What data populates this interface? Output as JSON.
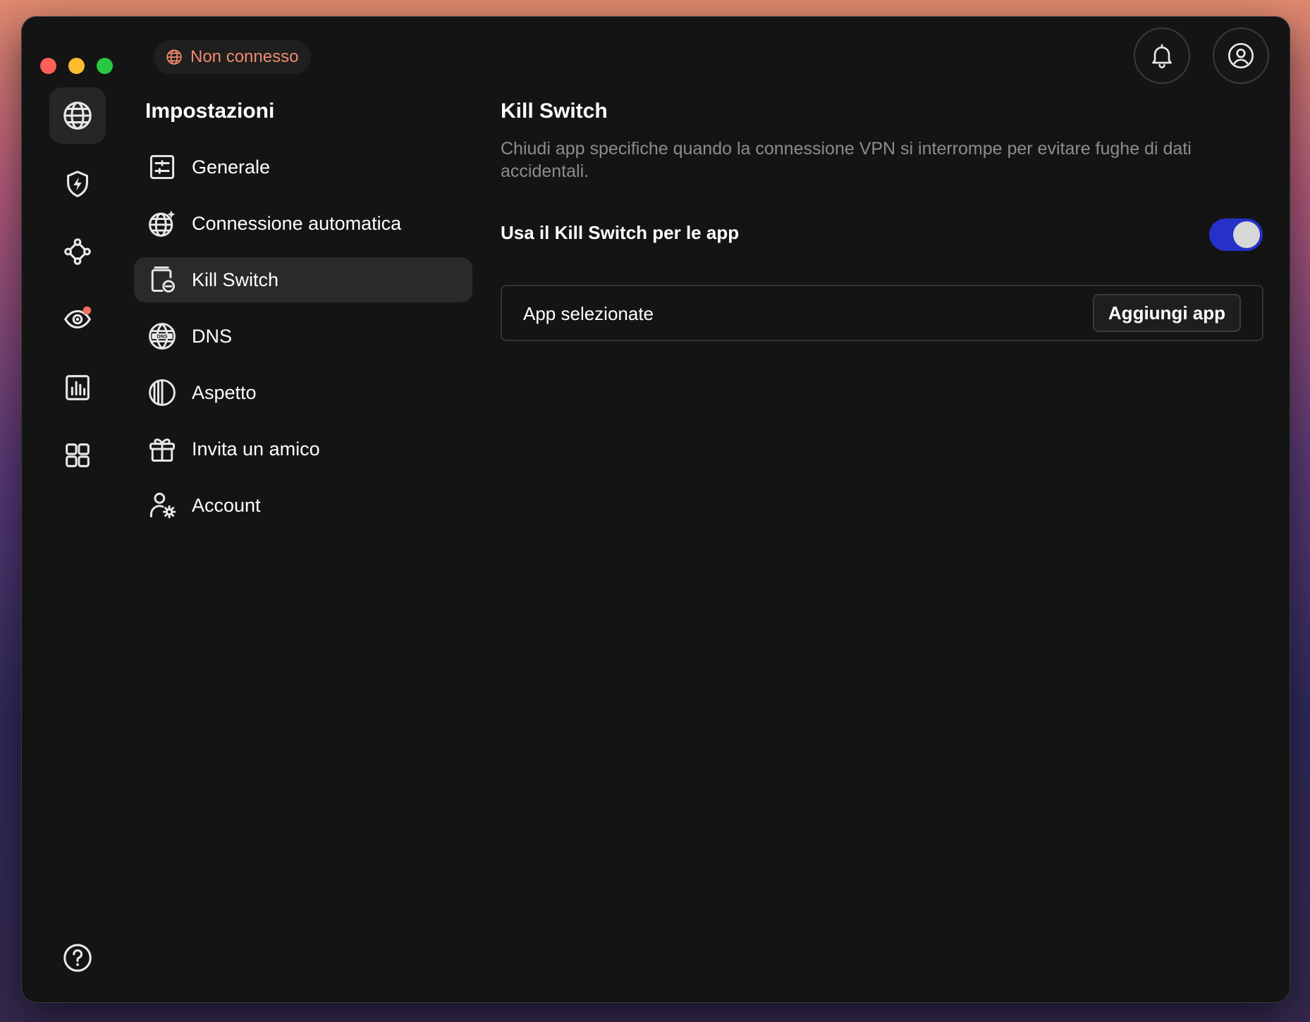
{
  "window": {
    "status": {
      "icon": "globe-icon",
      "label": "Non connesso",
      "color": "#f08a6f"
    },
    "top_buttons": [
      {
        "name": "notifications",
        "icon": "bell-icon"
      },
      {
        "name": "profile",
        "icon": "user-icon"
      }
    ]
  },
  "rail": [
    {
      "icon": "globe-icon",
      "active": true
    },
    {
      "icon": "shield-bolt-icon"
    },
    {
      "icon": "mesh-network-icon"
    },
    {
      "icon": "radar-icon",
      "badge": true
    },
    {
      "icon": "stats-chart-icon"
    },
    {
      "icon": "apps-grid-icon"
    },
    {
      "icon": "help-icon"
    }
  ],
  "settings": {
    "title": "Impostazioni",
    "items": [
      {
        "label": "Generale",
        "icon": "sliders-icon"
      },
      {
        "label": "Connessione automatica",
        "icon": "globe-sparkle-icon"
      },
      {
        "label": "Kill Switch",
        "icon": "kill-switch-icon",
        "active": true
      },
      {
        "label": "DNS",
        "icon": "dns-globe-icon"
      },
      {
        "label": "Aspetto",
        "icon": "appearance-icon"
      },
      {
        "label": "Invita un amico",
        "icon": "gift-icon"
      },
      {
        "label": "Account",
        "icon": "account-gear-icon"
      }
    ]
  },
  "content": {
    "title": "Kill Switch",
    "description": "Chiudi app specifiche quando la connessione VPN si interrompe per evitare fughe di dati accidentali.",
    "toggle_label": "Usa il Kill Switch per le app",
    "toggle_on": true,
    "accent": "#2531c7",
    "apps_label": "App selezionate",
    "add_button": "Aggiungi app"
  }
}
